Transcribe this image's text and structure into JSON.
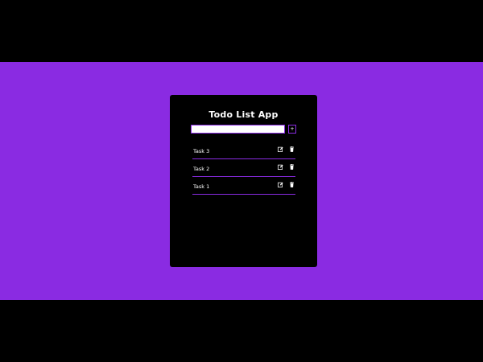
{
  "app": {
    "title": "Todo List App"
  },
  "input": {
    "value": "",
    "placeholder": "",
    "add_label": "+"
  },
  "tasks": [
    {
      "label": "Task 3",
      "edit_icon": "edit-icon",
      "delete_icon": "trash-icon"
    },
    {
      "label": "Task 2",
      "edit_icon": "edit-icon",
      "delete_icon": "trash-icon"
    },
    {
      "label": "Task 1",
      "edit_icon": "edit-icon",
      "delete_icon": "trash-icon"
    }
  ],
  "colors": {
    "page_background": "#000000",
    "accent": "#8a2be2",
    "card_background": "#000000",
    "text": "#ffffff"
  }
}
